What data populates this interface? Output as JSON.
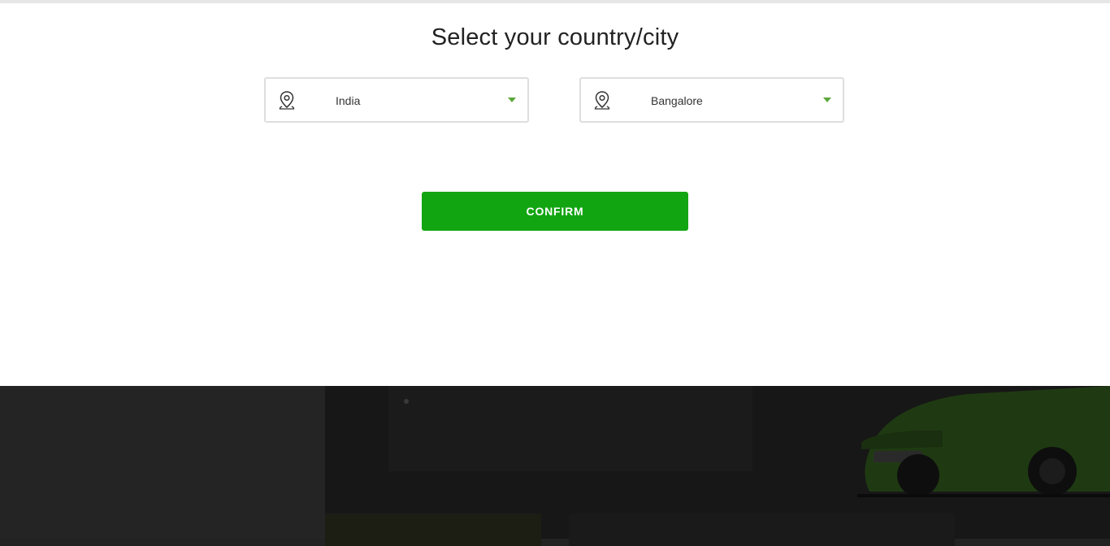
{
  "modal": {
    "title": "Select your country/city",
    "country": {
      "value": "India",
      "icon": "map-pin-icon"
    },
    "city": {
      "value": "Bangalore",
      "icon": "map-pin-icon"
    },
    "confirm_label": "CONFIRM"
  },
  "colors": {
    "accent": "#12a512",
    "caret": "#5aa83a",
    "overlay": "#222222"
  }
}
